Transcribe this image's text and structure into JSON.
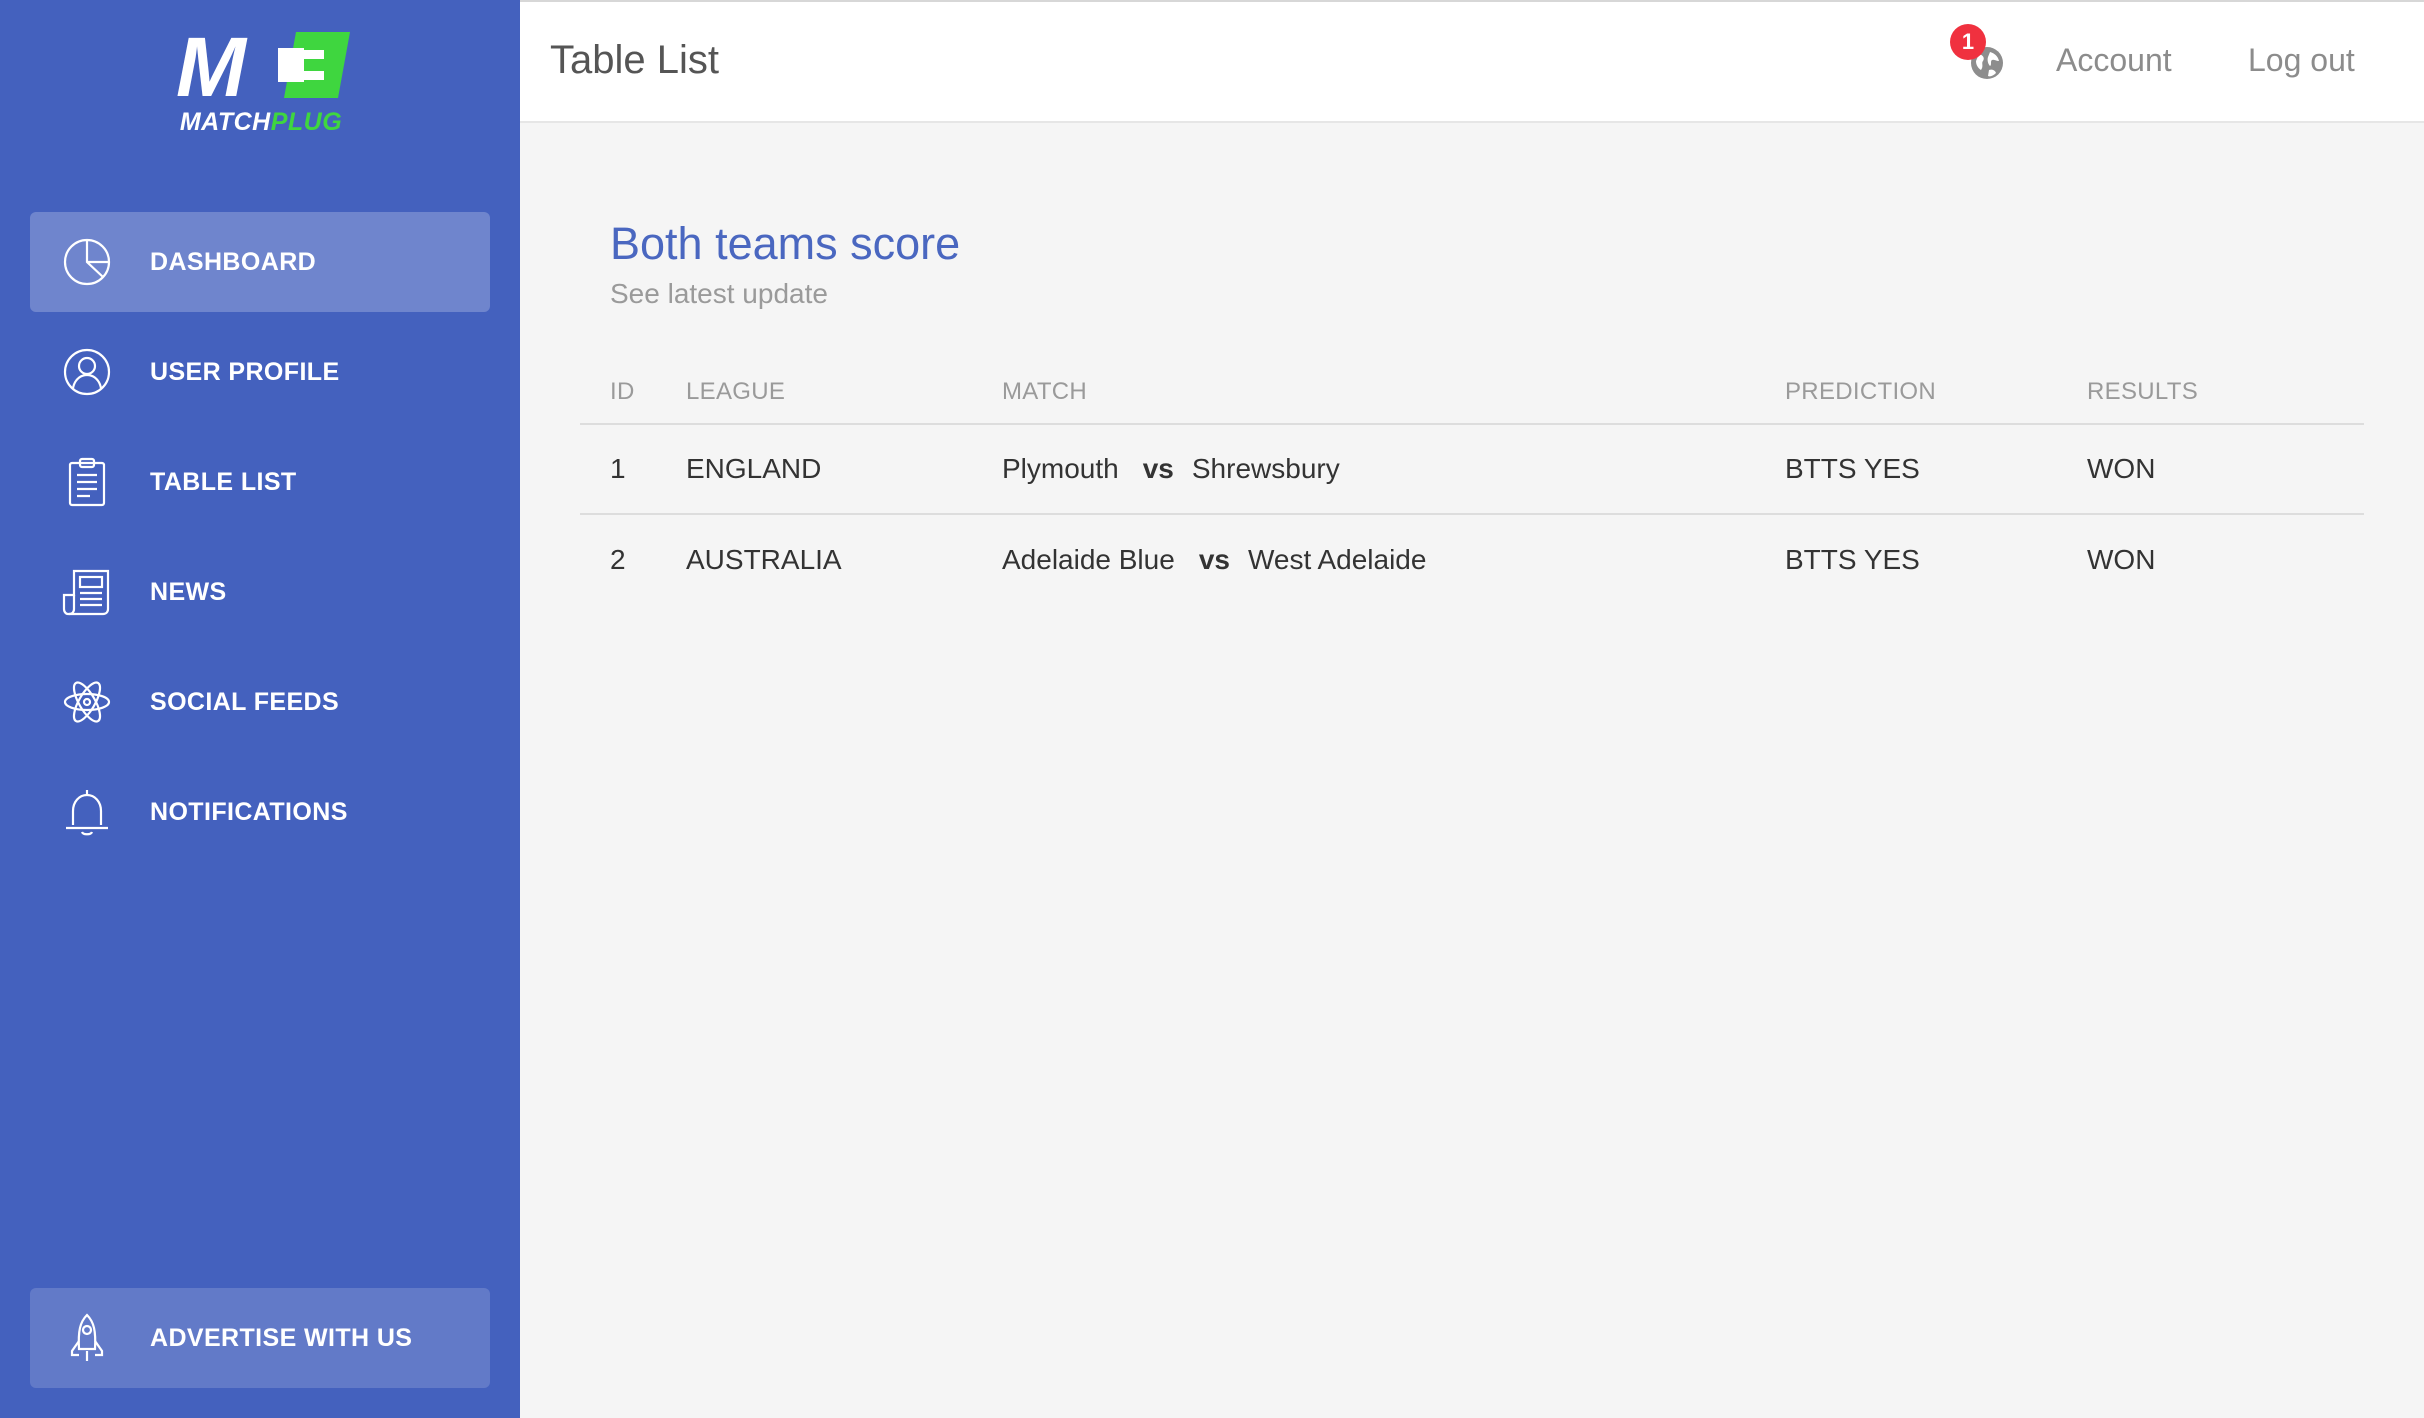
{
  "brand": {
    "logo_letters": "M",
    "name_part1": "MATCH",
    "name_part2": "PLUG",
    "accent_color": "#3fd63f",
    "sidebar_color": "#4461be"
  },
  "sidebar": {
    "items": [
      {
        "label": "DASHBOARD",
        "icon": "pie-chart-icon",
        "active": true
      },
      {
        "label": "USER PROFILE",
        "icon": "user-icon",
        "active": false
      },
      {
        "label": "TABLE LIST",
        "icon": "clipboard-icon",
        "active": false
      },
      {
        "label": "NEWS",
        "icon": "newspaper-icon",
        "active": false
      },
      {
        "label": "SOCIAL FEEDS",
        "icon": "atom-icon",
        "active": false
      },
      {
        "label": "NOTIFICATIONS",
        "icon": "bell-icon",
        "active": false
      }
    ],
    "advertise": {
      "label": "ADVERTISE WITH US",
      "icon": "rocket-icon"
    }
  },
  "topbar": {
    "title": "Table List",
    "notification_count": "1",
    "account_label": "Account",
    "logout_label": "Log out"
  },
  "main": {
    "title": "Both teams score",
    "subtitle": "See latest update",
    "columns": [
      "ID",
      "LEAGUE",
      "MATCH",
      "PREDICTION",
      "RESULTS"
    ],
    "rows": [
      {
        "id": "1",
        "league": "ENGLAND",
        "home": "Plymouth",
        "vs": "vs",
        "away": "Shrewsbury",
        "prediction": "BTTS YES",
        "result": "WON"
      },
      {
        "id": "2",
        "league": "AUSTRALIA",
        "home": "Adelaide Blue",
        "vs": "vs",
        "away": "West Adelaide",
        "prediction": "BTTS YES",
        "result": "WON"
      }
    ]
  }
}
